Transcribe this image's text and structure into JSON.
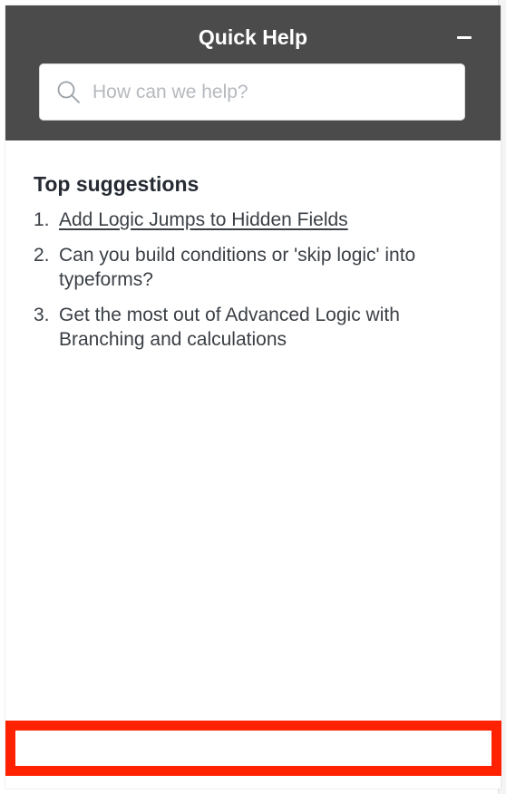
{
  "widget": {
    "title": "Quick Help",
    "minimize_icon": "minus-icon"
  },
  "search": {
    "placeholder": "How can we help?",
    "value": "",
    "icon": "search-icon"
  },
  "suggestions": {
    "heading": "Top suggestions",
    "items": [
      {
        "number": "1.",
        "label": "Add Logic Jumps to Hidden Fields"
      },
      {
        "number": "2.",
        "label": "Can you build conditions or 'skip logic' into typeforms?"
      },
      {
        "number": "3.",
        "label": "Get the most out of Advanced Logic with Branching and calculations"
      }
    ]
  },
  "colors": {
    "header_bg": "#4b4b4b",
    "highlight_border": "#ff2200",
    "heading_text": "#262b33",
    "body_text": "#3a3f45"
  }
}
